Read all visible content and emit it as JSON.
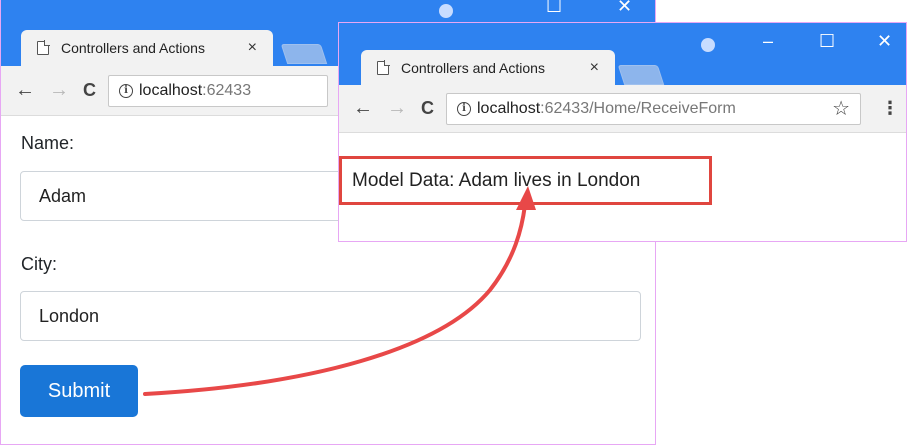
{
  "form_window": {
    "tab_title": "Controllers and Actions",
    "tab_close": "×",
    "url_host": "localhost",
    "url_rest": ":62433",
    "form": {
      "name_label": "Name:",
      "name_value": "Adam",
      "city_label": "City:",
      "city_value": "London",
      "submit_label": "Submit"
    }
  },
  "result_window": {
    "tab_title": "Controllers and Actions",
    "tab_close": "×",
    "url_host": "localhost",
    "url_rest": ":62433/Home/ReceiveForm",
    "model_text": "Model Data: Adam lives in London"
  },
  "icons": {
    "back": "←",
    "forward": "→",
    "reload": "C",
    "info": "i",
    "star": "☆",
    "menu": "⋮",
    "minimize": "–",
    "maximize": "☐",
    "close": "✕"
  },
  "colors": {
    "titlebar": "#2e82f0",
    "submit_button": "#1976d7",
    "highlight_red": "#e0463f",
    "window_border": "#e7a7f4"
  }
}
